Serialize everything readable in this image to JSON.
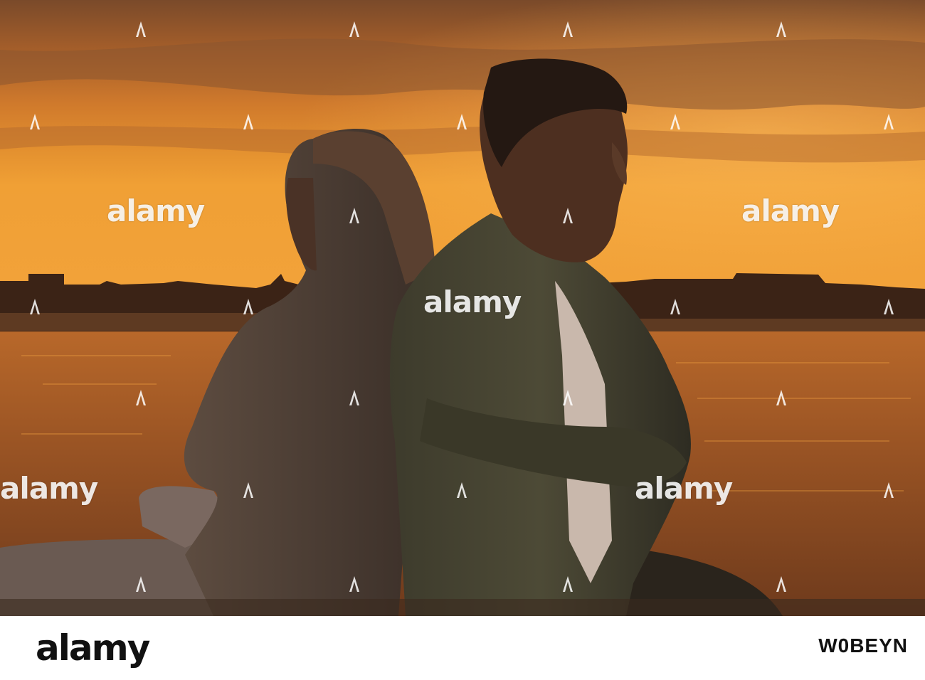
{
  "watermark": {
    "text": "alamy"
  },
  "footer": {
    "logo_text": "alamy",
    "image_id": "W0BEYN"
  }
}
